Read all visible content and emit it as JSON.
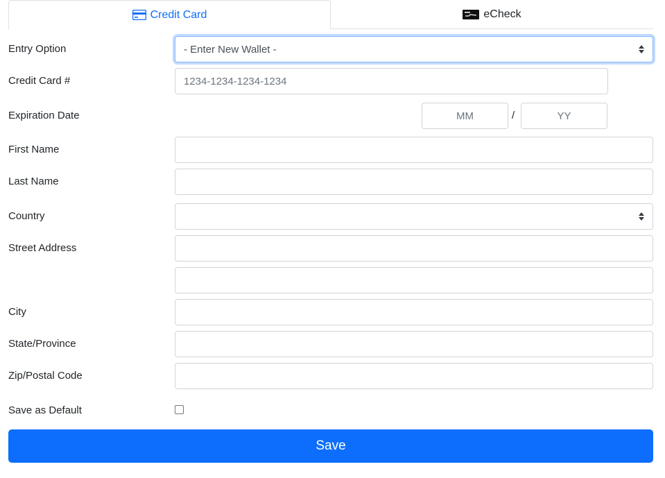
{
  "tabs": [
    {
      "label": "Credit Card",
      "icon": "credit-card-icon",
      "active": true
    },
    {
      "label": "eCheck",
      "icon": "check-icon",
      "active": false
    }
  ],
  "form": {
    "entry_option": {
      "label": "Entry Option",
      "value": "- Enter New Wallet -"
    },
    "credit_card": {
      "label": "Credit Card #",
      "placeholder": "1234-1234-1234-1234"
    },
    "expiration": {
      "label": "Expiration Date",
      "mm_placeholder": "MM",
      "yy_placeholder": "YY",
      "separator": "/"
    },
    "first_name": {
      "label": "First Name",
      "value": ""
    },
    "last_name": {
      "label": "Last Name",
      "value": ""
    },
    "country": {
      "label": "Country",
      "value": ""
    },
    "street_address": {
      "label": "Street Address",
      "line1": "",
      "line2": ""
    },
    "city": {
      "label": "City",
      "value": ""
    },
    "state": {
      "label": "State/Province",
      "value": ""
    },
    "zip": {
      "label": "Zip/Postal Code",
      "value": ""
    },
    "save_default": {
      "label": "Save as Default",
      "checked": false
    }
  },
  "actions": {
    "save_label": "Save"
  },
  "colors": {
    "accent": "#0d6efd",
    "border": "#ced4da",
    "text": "#212529"
  }
}
